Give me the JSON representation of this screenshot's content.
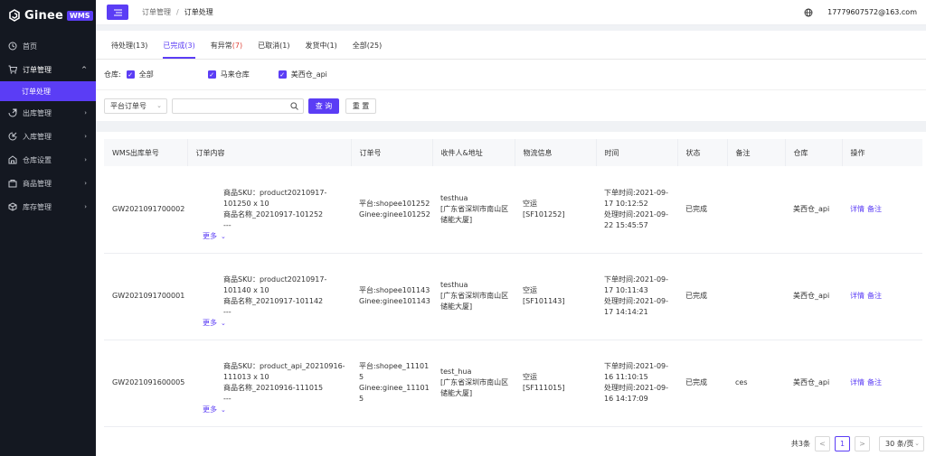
{
  "brand": {
    "name": "Ginee",
    "badge": "WMS",
    "accent": "#5b3df5",
    "sidebar_bg": "#141821"
  },
  "sidebar": {
    "items": [
      {
        "label": "首页",
        "icon": "home-icon"
      },
      {
        "label": "订单管理",
        "icon": "cart-icon"
      },
      {
        "label": "出库管理",
        "icon": "outbound-icon"
      },
      {
        "label": "入库管理",
        "icon": "inbound-icon"
      },
      {
        "label": "仓库设置",
        "icon": "warehouse-icon"
      },
      {
        "label": "商品管理",
        "icon": "goods-icon"
      },
      {
        "label": "库存管理",
        "icon": "inventory-icon"
      }
    ],
    "sub_active": "订单处理"
  },
  "header": {
    "breadcrumb": [
      "订单管理",
      "订单处理"
    ],
    "user": "17779607572@163.com"
  },
  "tabs": [
    {
      "label": "待处理",
      "count": "(13)"
    },
    {
      "label": "已完成",
      "count": "(3)"
    },
    {
      "label": "有异常",
      "count": "(7)"
    },
    {
      "label": "已取消",
      "count": "(1)"
    },
    {
      "label": "发货中",
      "count": "(1)"
    },
    {
      "label": "全部",
      "count": "(25)"
    }
  ],
  "warehouse_filter": {
    "label": "仓库:",
    "options": [
      "全部",
      "马来仓库",
      "美西仓_api"
    ]
  },
  "search": {
    "select_value": "平台订单号",
    "input_value": "",
    "query_label": "查 询",
    "reset_label": "重 置"
  },
  "table": {
    "columns": [
      "WMS出库单号",
      "订单内容",
      "订单号",
      "收件人&地址",
      "物流信息",
      "时间",
      "状态",
      "备注",
      "仓库",
      "操作"
    ],
    "rows": [
      {
        "wms_no": "GW2021091700002",
        "content": [
          "商品SKU：product20210917-",
          "101250 x 10",
          "商品名称_20210917-101252",
          "---"
        ],
        "more": "更多",
        "order": [
          "平台:shopee101252",
          "Ginee:ginee101252"
        ],
        "address": [
          "testhua",
          "[广东省深圳市南山区",
          "储能大厦]"
        ],
        "logistics": [
          "空运",
          "[SF101252]"
        ],
        "time": [
          "下单时间:2021-09-",
          "17 10:12:52",
          "处理时间:2021-09-",
          "22 15:45:57"
        ],
        "status": "已完成",
        "remark": "",
        "warehouse": "美西仓_api",
        "actions": [
          "详情",
          "备注"
        ]
      },
      {
        "wms_no": "GW2021091700001",
        "content": [
          "商品SKU：product20210917-",
          "101140 x 10",
          "商品名称_20210917-101142",
          "---"
        ],
        "more": "更多",
        "order": [
          "平台:shopee101143",
          "Ginee:ginee101143"
        ],
        "address": [
          "testhua",
          "[广东省深圳市南山区",
          "储能大厦]"
        ],
        "logistics": [
          "空运",
          "[SF101143]"
        ],
        "time": [
          "下单时间:2021-09-",
          "17 10:11:43",
          "处理时间:2021-09-",
          "17 14:14:21"
        ],
        "status": "已完成",
        "remark": "",
        "warehouse": "美西仓_api",
        "actions": [
          "详情",
          "备注"
        ]
      },
      {
        "wms_no": "GW2021091600005",
        "content": [
          "商品SKU：product_api_20210916-",
          "111013 x 10",
          "商品名称_20210916-111015",
          "---"
        ],
        "more": "更多",
        "order": [
          "平台:shopee_11101",
          "5",
          "Ginee:ginee_11101",
          "5"
        ],
        "address": [
          "test_hua",
          "[广东省深圳市南山区",
          "储能大厦]"
        ],
        "logistics": [
          "空运",
          "[SF111015]"
        ],
        "time": [
          "下单时间:2021-09-",
          "16 11:10:15",
          "处理时间:2021-09-",
          "16 14:17:09"
        ],
        "status": "已完成",
        "remark": "ces",
        "warehouse": "美西仓_api",
        "actions": [
          "详情",
          "备注"
        ]
      }
    ]
  },
  "pagination": {
    "total": "共3条",
    "prev": "<",
    "page": "1",
    "next": ">",
    "page_size": "30 条/页"
  }
}
